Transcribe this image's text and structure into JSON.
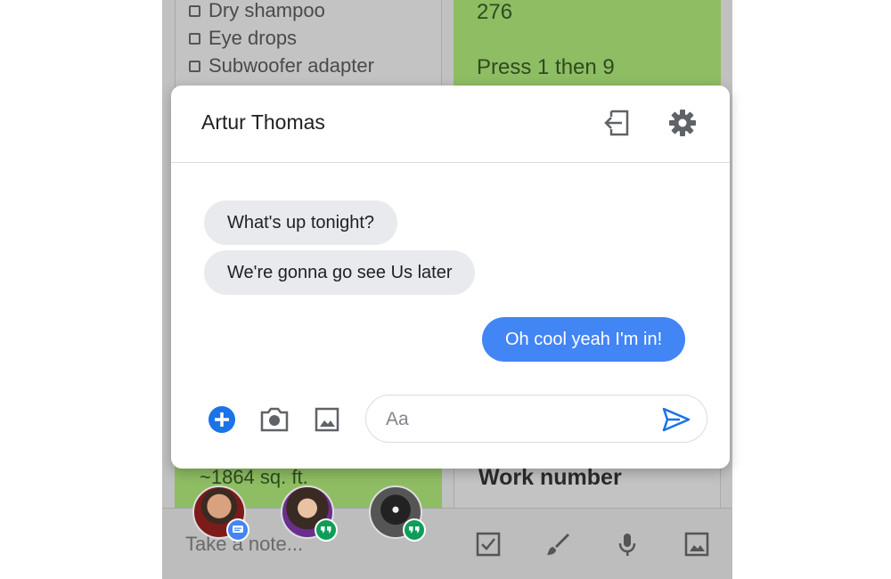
{
  "background": {
    "checklist": [
      "Dry shampoo",
      "Eye drops",
      "Subwoofer adapter"
    ],
    "green_note_top": {
      "line1": "276",
      "line2": "Press 1 then 9"
    },
    "green_note_bottom": "~1864 sq. ft.",
    "gray_note_bottom": "Work number",
    "take_note_placeholder": "Take a note...",
    "bottom_icons": [
      "checkbox-icon",
      "brush-icon",
      "mic-icon",
      "image-icon"
    ]
  },
  "chat_heads": [
    {
      "name": "avatar-1",
      "badge": "messages-icon",
      "badge_color": "#4285f4"
    },
    {
      "name": "avatar-2",
      "badge": "hangouts-icon",
      "badge_color": "#0f9d58"
    },
    {
      "name": "avatar-3",
      "badge": "hangouts-icon",
      "badge_color": "#0f9d58"
    }
  ],
  "chat": {
    "title": "Artur Thomas",
    "header_icons": [
      "exit-icon",
      "gear-icon"
    ],
    "messages": [
      {
        "direction": "in",
        "text": "What's up tonight?"
      },
      {
        "direction": "in",
        "text": "We're gonna go see Us later"
      },
      {
        "direction": "out",
        "text": "Oh cool yeah I'm in!"
      }
    ],
    "composer": {
      "placeholder": "Aa",
      "icons": [
        "add-icon",
        "camera-icon",
        "image-icon",
        "send-icon"
      ]
    }
  },
  "colors": {
    "accent_blue": "#4285f4",
    "note_green": "#8ebd63",
    "incoming_bubble": "#e8eaed"
  }
}
